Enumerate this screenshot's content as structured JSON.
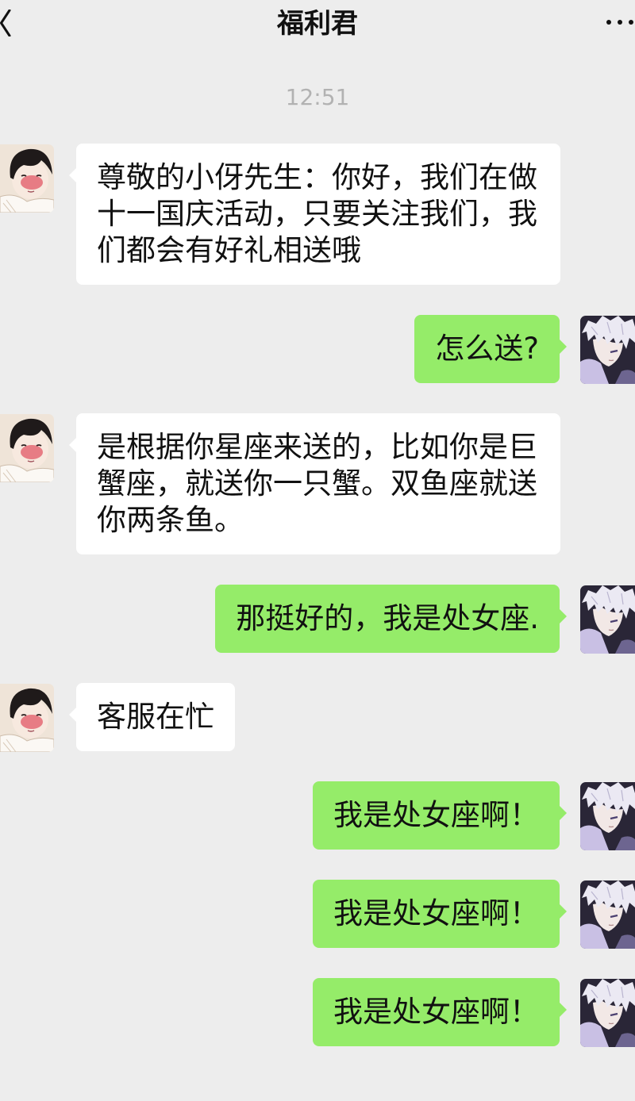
{
  "header": {
    "title": "福利君"
  },
  "timestamp": "12:51",
  "icons": {
    "back": "chevron-left-icon",
    "more": "more-dots-icon",
    "contact_avatar": "cartoon-boy-avatar",
    "my_avatar": "silver-hair-anime-avatar"
  },
  "colors": {
    "background": "#ededed",
    "received_bubble": "#ffffff",
    "sent_bubble": "#95ec69",
    "timestamp": "#b2b2b2"
  },
  "messages": [
    {
      "outgoing": false,
      "text": "尊敬的小伢先生：你好，我们在做十一国庆活动，只要关注我们，我们都会有好礼相送哦"
    },
    {
      "outgoing": true,
      "text": "怎么送?"
    },
    {
      "outgoing": false,
      "text": "是根据你星座来送的，比如你是巨蟹座，就送你一只蟹。双鱼座就送你两条鱼。"
    },
    {
      "outgoing": true,
      "text": "那挺好的，我是处女座."
    },
    {
      "outgoing": false,
      "text": "客服在忙"
    },
    {
      "outgoing": true,
      "text": "我是处女座啊！"
    },
    {
      "outgoing": true,
      "text": "我是处女座啊！"
    },
    {
      "outgoing": true,
      "text": "我是处女座啊！"
    }
  ]
}
